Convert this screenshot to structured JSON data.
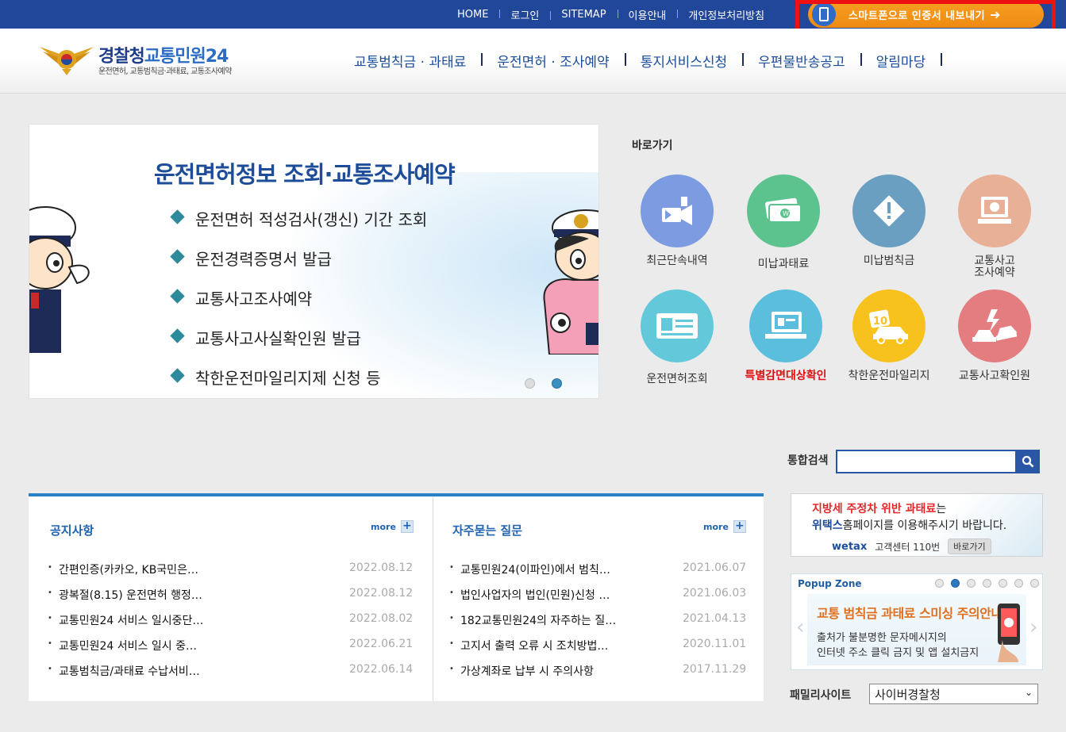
{
  "topbar": {
    "links": [
      "HOME",
      "로그인",
      "SITEMAP",
      "이용안내",
      "개인정보처리방침"
    ],
    "smartphone_button": "스마트폰으로 인증서 내보내기",
    "smartphone_icon": "phone-icon",
    "highlight_color": "#ee1111"
  },
  "header": {
    "logo_title_1": "경찰청",
    "logo_title_2": "교통민원24",
    "logo_subtitle": "운전면허, 교통범칙금·과태료, 교통조사예약",
    "nav": [
      "교통범칙금 · 과태료",
      "운전면허 · 조사예약",
      "통지서비스신청",
      "우편물반송공고",
      "알림마당"
    ]
  },
  "banner": {
    "title": "운전면허정보 조회·교통조사예약",
    "items": [
      "운전면허 적성검사(갱신) 기간 조회",
      "운전경력증명서 발급",
      "교통사고조사예약",
      "교통사고사실확인원 발급",
      "착한운전마일리지제 신청 등"
    ],
    "slide_count": 2,
    "active_slide": 2
  },
  "quick": {
    "title": "바로가기",
    "items": [
      {
        "label": "최근단속내역",
        "icon": "camera-icon",
        "color": "#7d9be0"
      },
      {
        "label": "미납과태료",
        "icon": "money-icon",
        "color": "#5cc38f"
      },
      {
        "label": "미납범칙금",
        "icon": "warning-icon",
        "color": "#6a9fc2"
      },
      {
        "label": "교통사고\n조사예약",
        "icon": "monitor-icon",
        "color": "#e8b197"
      },
      {
        "label": "운전면허조회",
        "icon": "license-card-icon",
        "color": "#63c8da"
      },
      {
        "label": "특별감면대상확인",
        "icon": "computer-icon",
        "color": "#5bbedd"
      },
      {
        "label": "착한운전마일리지",
        "icon": "mileage-car-icon",
        "color": "#f7c11e"
      },
      {
        "label": "교통사고확인원",
        "icon": "crash-icon",
        "color": "#e47d80"
      }
    ]
  },
  "search": {
    "label": "통합검색",
    "value": "",
    "icon": "search-icon"
  },
  "notice": {
    "title": "공지사항",
    "more": "more",
    "rows": [
      {
        "title": "간편인증(카카오, KB국민은…",
        "date": "2022.08.12"
      },
      {
        "title": "광복절(8.15) 운전면허 행정…",
        "date": "2022.08.12"
      },
      {
        "title": "교통민원24 서비스 일시중단…",
        "date": "2022.08.02"
      },
      {
        "title": "교통민원24 서비스 일시 중…",
        "date": "2022.06.21"
      },
      {
        "title": "교통범칙금/과태료 수납서비…",
        "date": "2022.06.14"
      }
    ]
  },
  "faq": {
    "title": "자주묻는 질문",
    "more": "more",
    "rows": [
      {
        "title": "교통민원24(이파인)에서 범칙…",
        "date": "2021.06.07"
      },
      {
        "title": "법인사업자의 법인(민원)신청 …",
        "date": "2021.06.03"
      },
      {
        "title": "182교통민원24의 자주하는 질…",
        "date": "2021.04.13"
      },
      {
        "title": "고지서 출력 오류 시 조치방법…",
        "date": "2020.11.01"
      },
      {
        "title": "가상계좌로 납부 시 주의사항",
        "date": "2017.11.29"
      }
    ]
  },
  "wetax": {
    "line1_red": "지방세 주정차 위반 과태료",
    "line1_rest": "는",
    "line2_bold": "위택스",
    "line2_rest": "홈페이지를 이용해주시기 바랍니다.",
    "logo": "wetax",
    "center": "고객센터 110번",
    "go": "바로가기"
  },
  "popup": {
    "title": "Popup Zone",
    "dot_count": 7,
    "active_dot": 2,
    "headline": "교통 범칙금 과태료 스미싱 주의안내",
    "line1": "출처가 불분명한 문자메시지의",
    "line2": "인터넷 주소 클릭 금지 및 앱 설치금지"
  },
  "family": {
    "label": "패밀리사이트",
    "selected": "사이버경찰청"
  }
}
